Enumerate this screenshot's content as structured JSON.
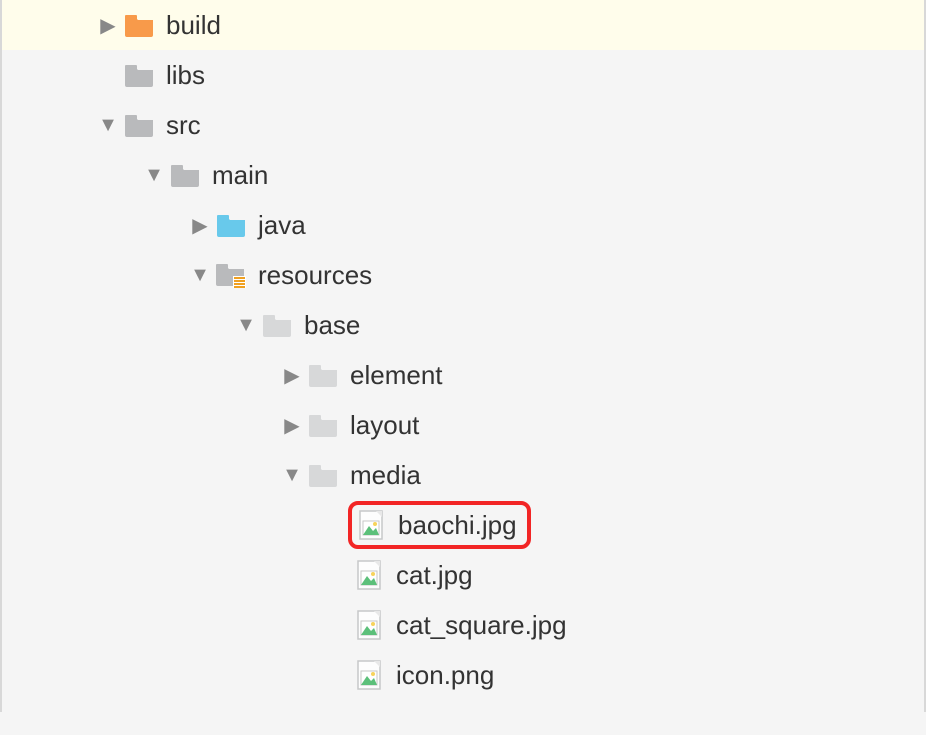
{
  "tree": {
    "build": "build",
    "libs": "libs",
    "src": "src",
    "main": "main",
    "java": "java",
    "resources": "resources",
    "base": "base",
    "element": "element",
    "layout": "layout",
    "media": "media",
    "baochi": "baochi.jpg",
    "cat": "cat.jpg",
    "cat_square": "cat_square.jpg",
    "icon": "icon.png"
  }
}
